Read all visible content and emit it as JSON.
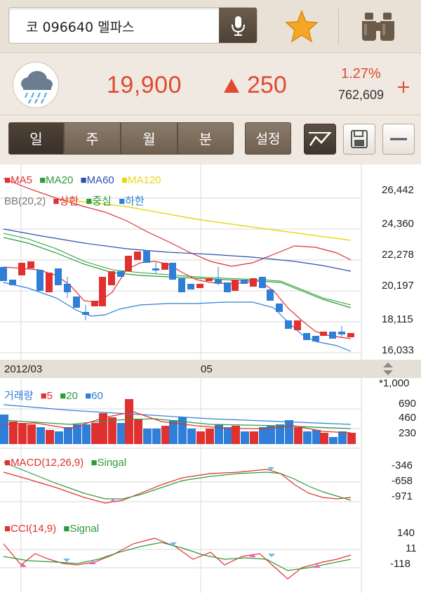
{
  "search": {
    "query": "코 096640 멜파스"
  },
  "quote": {
    "price": "19,900",
    "change": "250",
    "percent": "1.27%",
    "volume": "762,609"
  },
  "tabs": [
    {
      "label": "일"
    },
    {
      "label": "주"
    },
    {
      "label": "월"
    },
    {
      "label": "분"
    }
  ],
  "settings_label": "설정",
  "price_chart": {
    "ma_legend": [
      {
        "label": "MA5",
        "color": "#e03030"
      },
      {
        "label": "MA20",
        "color": "#2f9a3a"
      },
      {
        "label": "MA60",
        "color": "#2f4fae"
      },
      {
        "label": "MA120",
        "color": "#e8d81a"
      }
    ],
    "bb_label": "BB(20,2)",
    "bb_legend": [
      {
        "label": "상한",
        "color": "#e03030"
      },
      {
        "label": "중심",
        "color": "#2f9a3a"
      },
      {
        "label": "하한",
        "color": "#2f7fd8"
      }
    ],
    "y_ticks": [
      "26,442",
      "24,360",
      "22,278",
      "20,197",
      "18,115",
      "16,033"
    ],
    "dates": [
      "2012/03",
      "05"
    ]
  },
  "volume_chart": {
    "title": "거래량",
    "legend": [
      {
        "label": "5",
        "color": "#e03030"
      },
      {
        "label": "20",
        "color": "#2f9a3a"
      },
      {
        "label": "60",
        "color": "#2f7fd8"
      }
    ],
    "unit": "*1,000",
    "y_ticks": [
      "690",
      "460",
      "230"
    ]
  },
  "macd_chart": {
    "legend": [
      {
        "label": "MACD(12,26,9)",
        "color": "#e03030"
      },
      {
        "label": "Singal",
        "color": "#2f9a3a"
      }
    ],
    "y_ticks": [
      "-346",
      "-658",
      "-971"
    ]
  },
  "cci_chart": {
    "legend": [
      {
        "label": "CCI(14,9)",
        "color": "#e03030"
      },
      {
        "label": "Signal",
        "color": "#2f9a3a"
      }
    ],
    "y_ticks": [
      "140",
      "11",
      "-118"
    ]
  },
  "colors": {
    "up": "#e03030",
    "down": "#2f7fd8",
    "price_red": "#e04a2f",
    "star": "#f5a623",
    "toolbar_brown": "#6f5f50"
  },
  "icons": {
    "mic": "microphone-icon",
    "star": "star-icon",
    "binoculars": "binoculars-icon",
    "weather": "rain-cloud-icon",
    "plus": "plus-icon",
    "draw": "trendline-icon",
    "save": "save-icon",
    "minus": "minus-icon"
  }
}
